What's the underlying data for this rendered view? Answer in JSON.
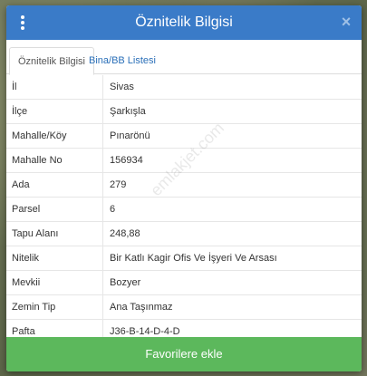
{
  "dialog": {
    "title": "Öznitelik Bilgisi",
    "close_glyph": "×",
    "menu_icon": "vertical-ellipsis-icon",
    "close_icon": "close-icon"
  },
  "tabs": [
    {
      "label": "Öznitelik Bilgisi",
      "active": true
    },
    {
      "label": "Bina/BB Listesi",
      "active": false
    }
  ],
  "rows": [
    {
      "key": "İl",
      "value": "Sivas"
    },
    {
      "key": "İlçe",
      "value": "Şarkışla"
    },
    {
      "key": "Mahalle/Köy",
      "value": "Pınarönü"
    },
    {
      "key": "Mahalle No",
      "value": "156934"
    },
    {
      "key": "Ada",
      "value": "279"
    },
    {
      "key": "Parsel",
      "value": "6"
    },
    {
      "key": "Tapu Alanı",
      "value": "248,88"
    },
    {
      "key": "Nitelik",
      "value": "Bir Katlı Kagir Ofis Ve İşyeri Ve Arsası"
    },
    {
      "key": "Mevkii",
      "value": "Bozyer"
    },
    {
      "key": "Zemin Tip",
      "value": "Ana Taşınmaz"
    },
    {
      "key": "Pafta",
      "value": "J36-B-14-D-4-D"
    }
  ],
  "watermark": "emlakjet.com",
  "footer": {
    "button_label": "Favorilere ekle"
  },
  "colors": {
    "header": "#3a7bc8",
    "tab_link": "#2a6fb8",
    "footer_button": "#5cb85c"
  }
}
